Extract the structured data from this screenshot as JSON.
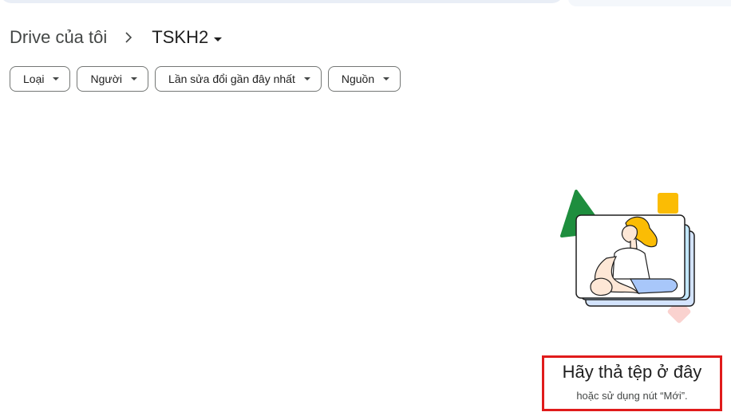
{
  "breadcrumb": {
    "root": "Drive của tôi",
    "current": "TSKH2"
  },
  "filters": [
    {
      "label": "Loại"
    },
    {
      "label": "Người"
    },
    {
      "label": "Lần sửa đổi gần đây nhất"
    },
    {
      "label": "Nguồn"
    }
  ],
  "empty_state": {
    "title": "Hãy thả tệp ở đây",
    "subtitle": "hoặc sử dụng nút “Mới”."
  },
  "colors": {
    "highlight_border": "#e01b1b",
    "green_shape": "#1e8e3e",
    "yellow_shape": "#fbbc04",
    "pink_shape": "#fad2cf",
    "card_blue": "#c2e7ff"
  },
  "icons": {
    "breadcrumb_separator": "chevron-right-icon",
    "folder_menu": "arrow-drop-down-icon",
    "filter_caret": "arrow-drop-down-icon"
  }
}
